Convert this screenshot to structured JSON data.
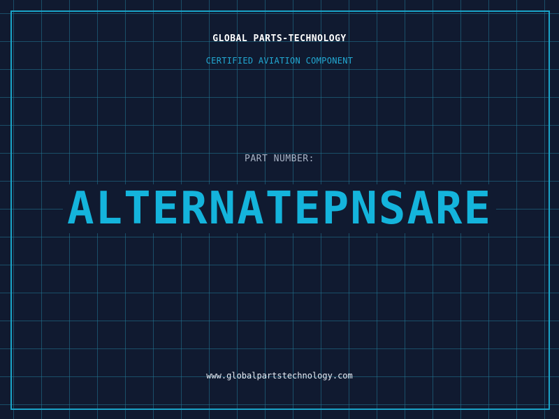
{
  "header": {
    "company": "GLOBAL PARTS-TECHNOLOGY",
    "subtitle": "CERTIFIED AVIATION COMPONENT"
  },
  "part": {
    "label": "PART NUMBER:",
    "number": "ALTERNATEPNSARE"
  },
  "footer": {
    "website": "www.globalpartstechnology.com"
  },
  "colors": {
    "background": "#101a30",
    "grid": "#22789a",
    "frame": "#1aa3c7",
    "accent": "#14b4dc",
    "subtitle": "#22a8d2",
    "label": "#a9b4c6",
    "text": "#ffffff"
  }
}
